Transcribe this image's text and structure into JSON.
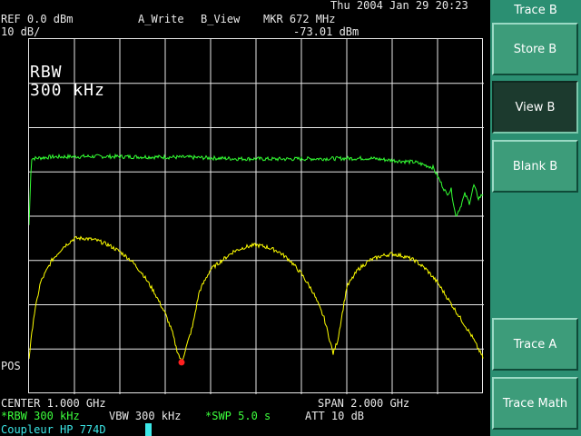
{
  "header": {
    "datetime": "Thu 2004 Jan 29 20:23",
    "ref_level": "REF 0.0 dBm",
    "scale": "10 dB/",
    "trace_a_mode": "A_Write",
    "trace_b_mode": "B_View",
    "marker_freq": "MKR 672 MHz",
    "marker_level": "-73.01 dBm"
  },
  "overlay": {
    "rbw_line1": "RBW",
    "rbw_line2": "300 kHz",
    "pos_label": "POS"
  },
  "footer": {
    "center": "CENTER 1.000 GHz",
    "span": "SPAN 2.000 GHz",
    "rbw": "*RBW 300 kHz",
    "vbw": "VBW 300 kHz",
    "sweep": "*SWP 5.0 s",
    "atten": "ATT 10 dB",
    "status_message": "Coupleur HP 774D"
  },
  "softkeys": {
    "title": "Trace B",
    "items": [
      {
        "label": "Store B",
        "active": false
      },
      {
        "label": "View B",
        "active": true
      },
      {
        "label": "Blank B",
        "active": false
      },
      {
        "label": "Trace A",
        "active": false
      },
      {
        "label": "Trace Math",
        "active": false
      }
    ]
  },
  "colors": {
    "trace_a": "#ffff00",
    "trace_b": "#33ff33",
    "marker": "#ff2020",
    "grid": "#e8e8e8",
    "panel": "#2b8f72"
  },
  "chart_data": {
    "type": "line",
    "x_axis": {
      "center_ghz": 1.0,
      "span_ghz": 2.0,
      "range_ghz": [
        0.0,
        2.0
      ],
      "divisions": 10
    },
    "y_axis": {
      "ref_dbm": 0.0,
      "db_per_div": 10,
      "range_dbm": [
        -80,
        0
      ],
      "divisions": 8
    },
    "grid": true,
    "marker": {
      "freq_ghz": 0.672,
      "level_dbm": -73.01
    },
    "series": [
      {
        "trace": "B",
        "color": "#33ff33",
        "x_ghz": [
          0.0,
          0.01,
          0.1,
          0.3,
          0.5,
          0.7,
          0.9,
          1.1,
          1.3,
          1.5,
          1.6,
          1.7,
          1.78,
          1.8,
          1.84,
          1.86,
          1.88,
          1.9,
          1.92,
          1.94,
          1.96,
          1.98,
          2.0
        ],
        "y_dbm": [
          -42,
          -27,
          -26.6,
          -26.5,
          -26.6,
          -26.7,
          -27.0,
          -27.1,
          -27.0,
          -26.9,
          -27.4,
          -27.8,
          -29,
          -31,
          -35,
          -34,
          -40,
          -38,
          -35,
          -37,
          -33,
          -36,
          -35
        ]
      },
      {
        "trace": "A",
        "color": "#ffff00",
        "x_ghz": [
          0.0,
          0.02,
          0.05,
          0.1,
          0.15,
          0.2,
          0.25,
          0.3,
          0.35,
          0.4,
          0.45,
          0.5,
          0.55,
          0.6,
          0.63,
          0.65,
          0.672,
          0.69,
          0.72,
          0.75,
          0.8,
          0.85,
          0.9,
          0.95,
          1.0,
          1.05,
          1.1,
          1.15,
          1.2,
          1.25,
          1.3,
          1.32,
          1.34,
          1.36,
          1.38,
          1.4,
          1.45,
          1.5,
          1.55,
          1.6,
          1.65,
          1.7,
          1.75,
          1.8,
          1.85,
          1.9,
          1.95,
          2.0
        ],
        "y_dbm": [
          -72,
          -63,
          -55,
          -50,
          -47,
          -45,
          -45,
          -45.5,
          -46.5,
          -48,
          -50,
          -53,
          -57,
          -62,
          -66,
          -70,
          -73,
          -70,
          -65,
          -57,
          -52,
          -50,
          -48,
          -47,
          -46.5,
          -47,
          -48,
          -50,
          -53,
          -57,
          -63,
          -67,
          -71,
          -68,
          -62,
          -56,
          -52,
          -50,
          -49,
          -48.5,
          -49,
          -50,
          -52,
          -55,
          -59,
          -63,
          -67,
          -72
        ]
      }
    ]
  }
}
